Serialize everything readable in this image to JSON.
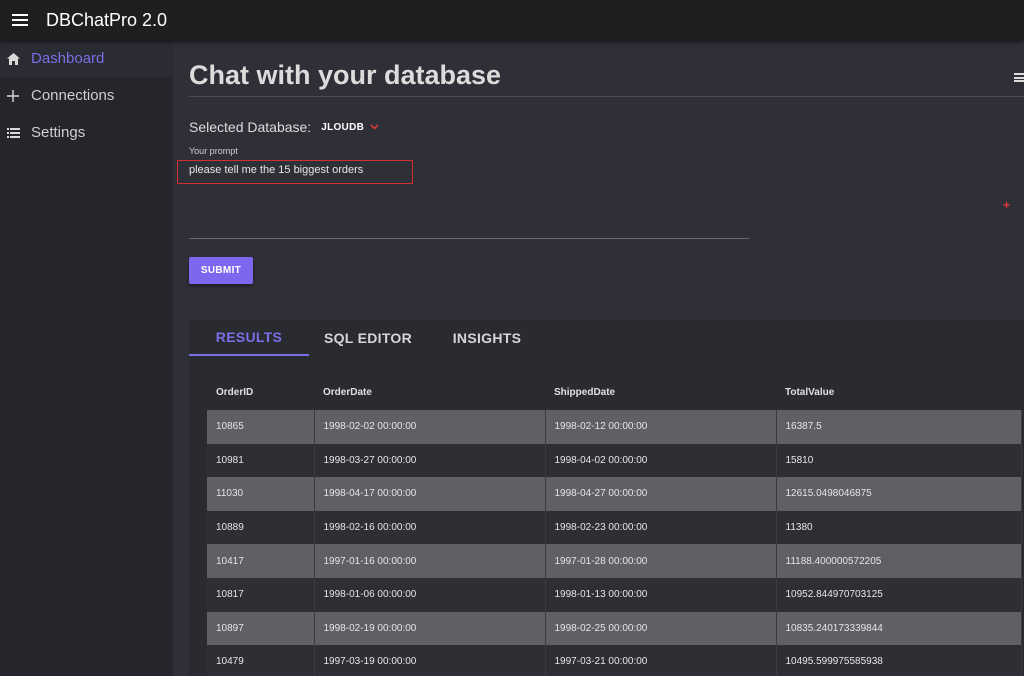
{
  "app": {
    "title": "DBChatPro 2.0"
  },
  "sidebar": {
    "items": [
      {
        "label": "Dashboard",
        "icon": "home-icon"
      },
      {
        "label": "Connections",
        "icon": "plus-icon"
      },
      {
        "label": "Settings",
        "icon": "list-icon"
      }
    ]
  },
  "page": {
    "title": "Chat with your database",
    "db_label": "Selected Database:",
    "db_value": "JLOUDB",
    "prompt_label": "Your prompt",
    "prompt_value": "please tell me the 15 biggest orders",
    "submit_label": "SUBMIT",
    "plus_symbol": "+"
  },
  "tabs": [
    {
      "label": "RESULTS"
    },
    {
      "label": "SQL EDITOR"
    },
    {
      "label": "INSIGHTS"
    }
  ],
  "table": {
    "columns": [
      "OrderID",
      "OrderDate",
      "ShippedDate",
      "TotalValue"
    ],
    "rows": [
      [
        "10865",
        "1998-02-02 00:00:00",
        "1998-02-12 00:00:00",
        "16387.5"
      ],
      [
        "10981",
        "1998-03-27 00:00:00",
        "1998-04-02 00:00:00",
        "15810"
      ],
      [
        "11030",
        "1998-04-17 00:00:00",
        "1998-04-27 00:00:00",
        "12615.0498046875"
      ],
      [
        "10889",
        "1998-02-16 00:00:00",
        "1998-02-23 00:00:00",
        "11380"
      ],
      [
        "10417",
        "1997-01-16 00:00:00",
        "1997-01-28 00:00:00",
        "11188.400000572205"
      ],
      [
        "10817",
        "1998-01-06 00:00:00",
        "1998-01-13 00:00:00",
        "10952.844970703125"
      ],
      [
        "10897",
        "1998-02-19 00:00:00",
        "1998-02-25 00:00:00",
        "10835.240173339844"
      ],
      [
        "10479",
        "1997-03-19 00:00:00",
        "1997-03-21 00:00:00",
        "10495.599975585938"
      ]
    ]
  },
  "colors": {
    "accent": "#7b68ee",
    "highlight_border": "#d32f2f"
  }
}
